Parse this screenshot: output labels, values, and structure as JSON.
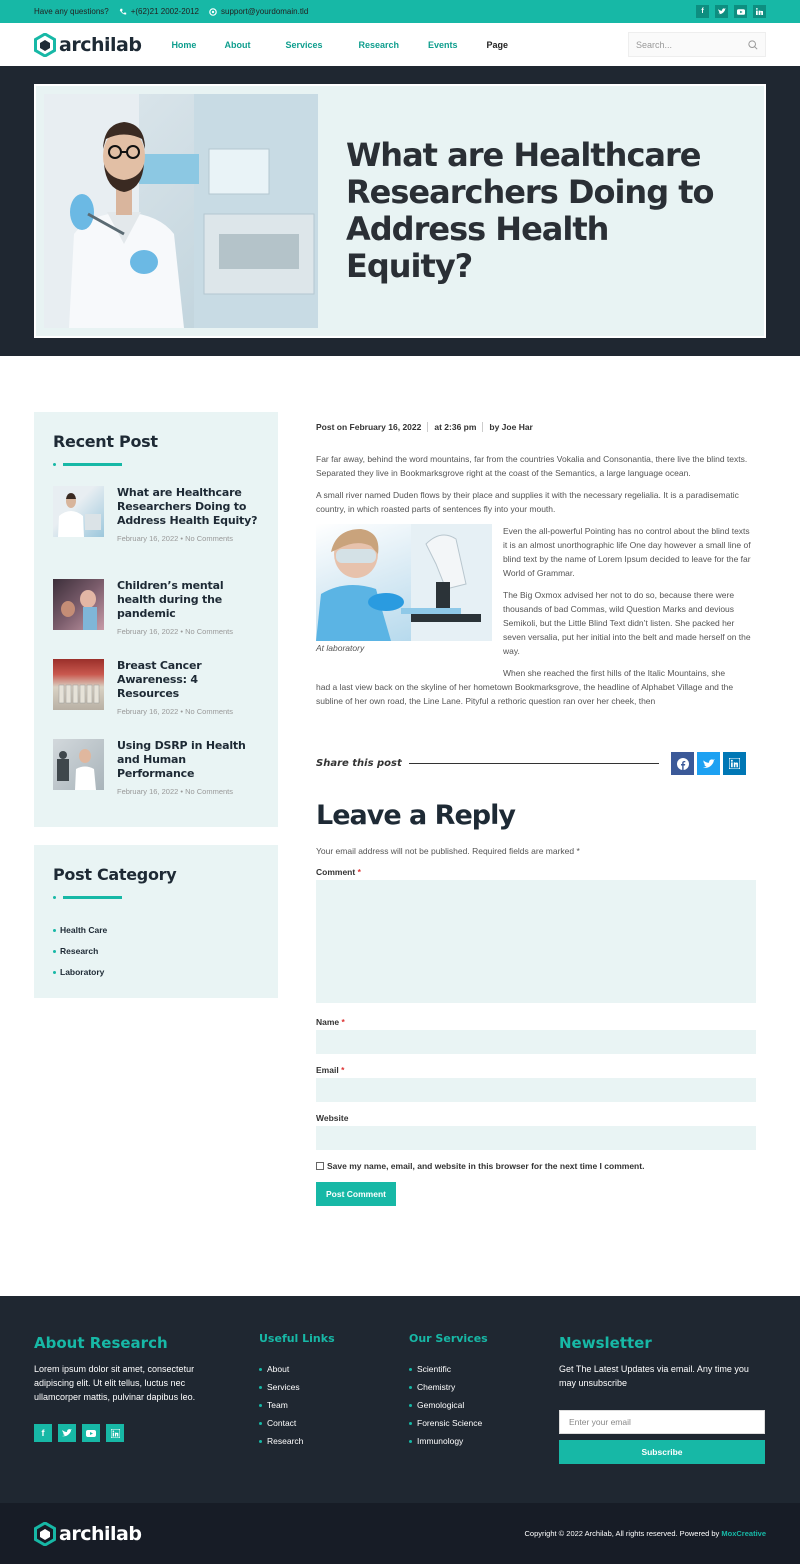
{
  "topbar": {
    "question": "Have any questions?",
    "phone": "+(62)21 2002-2012",
    "email": "support@yourdomain.tld",
    "socials": [
      "f",
      "t",
      "yt",
      "in"
    ]
  },
  "header": {
    "logo": "archilab",
    "nav": [
      "Home",
      "About",
      "Services",
      "Research",
      "Events",
      "Page"
    ],
    "search_placeholder": "Search..."
  },
  "hero": {
    "title": "What are Healthcare Researchers Doing to Address Health Equity?"
  },
  "sidebar": {
    "recent_title": "Recent Post",
    "recent_posts": [
      {
        "title": "What are Healthcare Researchers Doing to Address Health Equity?",
        "meta": "February 16, 2022 • No Comments"
      },
      {
        "title": "Children’s mental health during the pandemic",
        "meta": "February 16, 2022 • No Comments"
      },
      {
        "title": "Breast Cancer Awareness: 4 Resources",
        "meta": "February 16, 2022 • No Comments"
      },
      {
        "title": "Using DSRP in Health and Human Performance",
        "meta": "February 16, 2022 • No Comments"
      }
    ],
    "category_title": "Post Category",
    "categories": [
      "Health Care",
      "Research",
      "Laboratory"
    ]
  },
  "post": {
    "date": "Post on February 16, 2022",
    "time": "at 2:36 pm",
    "author": "by Joe Har",
    "p1": "Far far away, behind the word mountains, far from the countries Vokalia and Consonantia, there live the blind texts. Separated they live in Bookmarksgrove right at the coast of the Semantics, a large language ocean.",
    "p2": "A small river named Duden flows by their place and supplies it with the necessary regelialia. It is a paradisematic country, in which roasted parts of sentences fly into your mouth.",
    "p3": "Even the all-powerful Pointing has no control about the blind texts it is an almost unorthographic life One day however a small line of blind text by the name of Lorem Ipsum decided to leave for the far World of Grammar.",
    "p4": "The Big Oxmox advised her not to do so, because there were thousands of bad Commas, wild Question Marks and devious Semikoli, but the Little Blind Text didn’t listen. She packed her seven versalia, put her initial into the belt and made herself on the way.",
    "p5a": "When she reached the first hills of the Italic Mountains, she",
    "p5b": "had a last view back on the skyline of her hometown Bookmarksgrove, the headline of Alphabet Village and the subline of her own road, the Line Lane. Pityful a rethoric question ran over her cheek, then",
    "caption": "At laboratory",
    "share_label": "Share this post"
  },
  "reply": {
    "title": "Leave a Reply",
    "note": "Your email address will not be published. Required fields are marked *",
    "comment_label": "Comment",
    "name_label": "Name",
    "email_label": "Email",
    "website_label": "Website",
    "required_mark": "*",
    "save_label": "Save my name, email, and website in this browser for the next time I comment.",
    "submit": "Post Comment"
  },
  "footer": {
    "about_title": "About Research",
    "about_text": "Lorem ipsum dolor sit amet, consectetur adipiscing elit. Ut elit tellus, luctus nec ullamcorper mattis, pulvinar dapibus leo.",
    "links_title": "Useful Links",
    "links": [
      "About",
      "Services",
      "Team",
      "Contact",
      "Research"
    ],
    "services_title": "Our Services",
    "services": [
      "Scientific",
      "Chemistry",
      "Gemological",
      "Forensic Science",
      "Immunology"
    ],
    "newsletter_title": "Newsletter",
    "newsletter_text": "Get The Latest Updates via email. Any time you may unsubscribe",
    "email_placeholder": "Enter your email",
    "subscribe": "Subscribe",
    "copyright": "Copyright © 2022 Archilab, All rights reserved. Powered by",
    "powered": "MoxCreative",
    "logo": "archilab"
  },
  "colors": {
    "accent": "#17b8a6",
    "dark": "#1f2731",
    "light": "#e9f4f4"
  }
}
